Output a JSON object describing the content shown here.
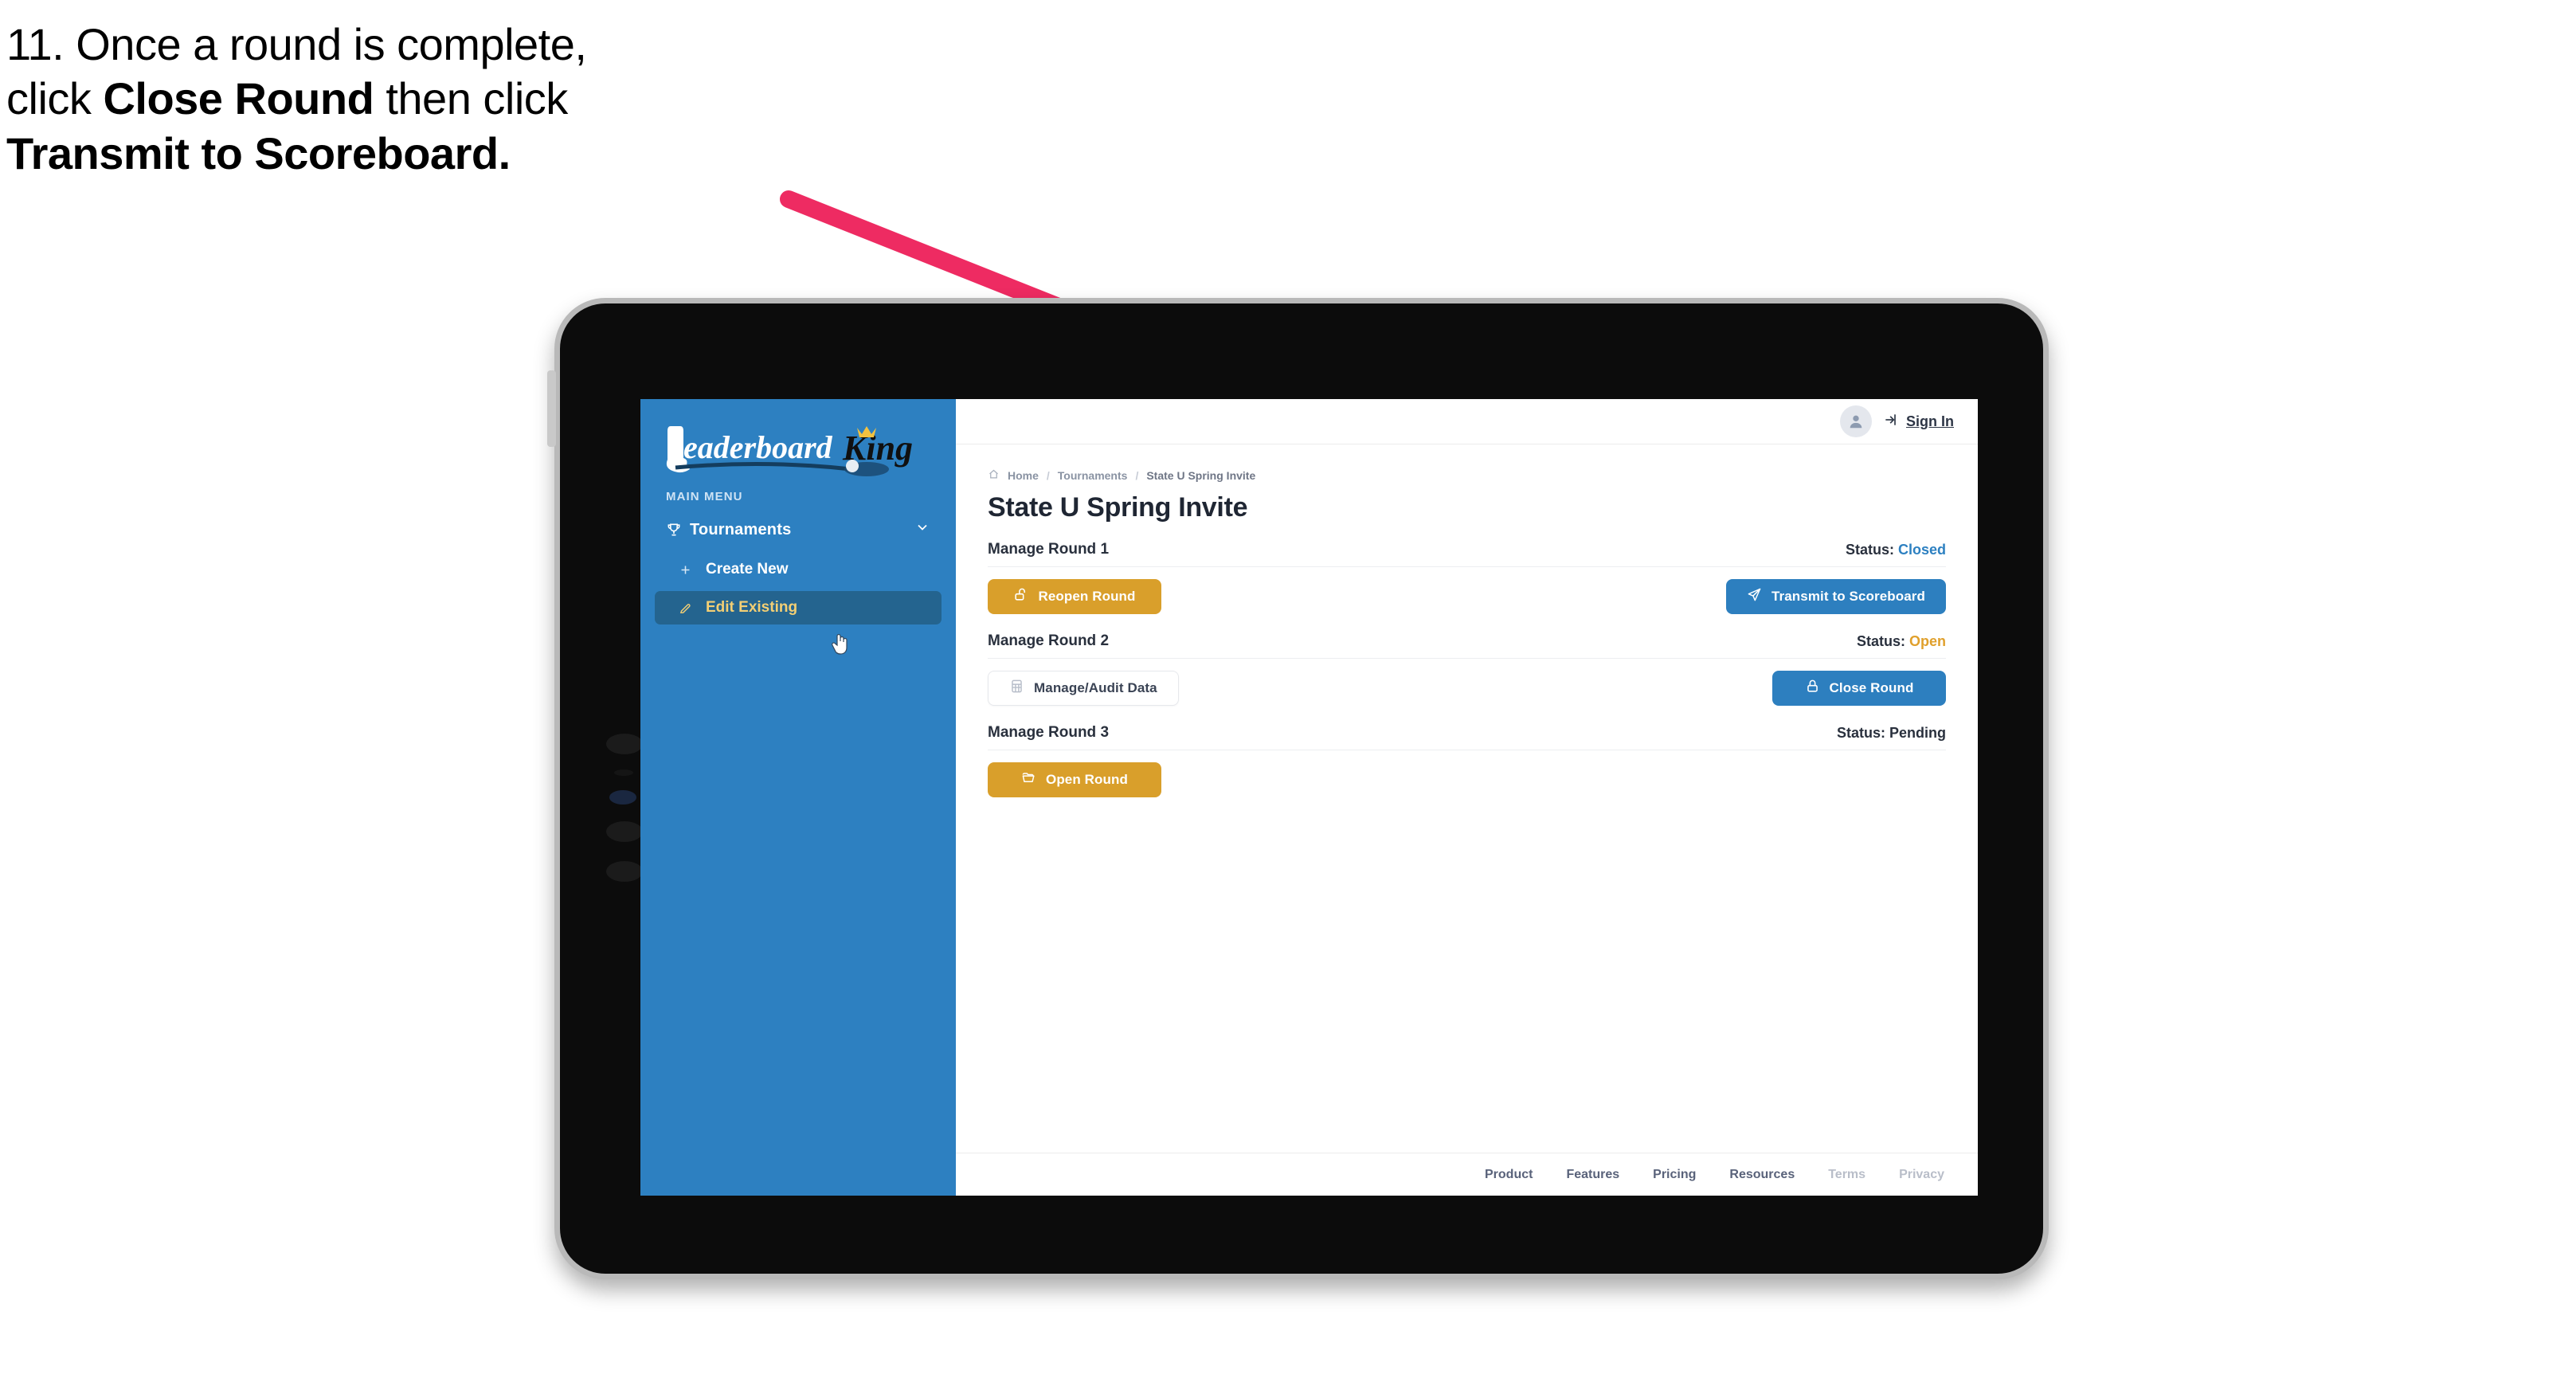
{
  "instruction": {
    "step_number": "11.",
    "line1_pre": "11. Once a round is complete,",
    "line2_pre": "click ",
    "line2_bold": "Close Round",
    "line2_post": " then click",
    "line3_bold": "Transmit to Scoreboard."
  },
  "colors": {
    "arrow": "#ee2b62",
    "sidebar_blue": "#2d80c1",
    "primary_blue": "#2d7fbf",
    "gold": "#d99f2b",
    "active_item_bg": "#24648f",
    "active_item_text": "#f3cf74",
    "status_open": "#e0a02c",
    "status_closed": "#2d80c1",
    "tablet_body": "#0c0c0c",
    "tablet_bezel": "#b9b9b9"
  },
  "sidebar": {
    "logo_text_primary": "Leaderboard",
    "logo_text_secondary": "King",
    "section_label": "MAIN MENU",
    "items": [
      {
        "label": "Tournaments",
        "icon": "trophy-icon",
        "expanded": true,
        "chevron": "chevron-down-icon"
      },
      {
        "label": "Create New",
        "icon": "plus-icon",
        "active": false
      },
      {
        "label": "Edit Existing",
        "icon": "edit-pencil-icon",
        "active": true
      }
    ]
  },
  "topbar": {
    "avatar_icon": "user-avatar-icon",
    "signin_label": "Sign In",
    "signin_icon": "login-arrow-icon"
  },
  "main": {
    "breadcrumb": {
      "home_icon": "home-icon",
      "items": [
        "Home",
        "Tournaments",
        "State U Spring Invite"
      ],
      "separator": "/"
    },
    "page_title": "State U Spring Invite",
    "rounds": [
      {
        "title": "Manage Round 1",
        "status_label": "Status:",
        "status_value": "Closed",
        "status_kind": "closed",
        "left_button": {
          "label": "Reopen Round",
          "icon": "unlock-icon",
          "style": "gold"
        },
        "right_button": {
          "label": "Transmit to Scoreboard",
          "icon": "paper-plane-icon",
          "style": "blue"
        }
      },
      {
        "title": "Manage Round 2",
        "status_label": "Status:",
        "status_value": "Open",
        "status_kind": "open",
        "left_button": {
          "label": "Manage/Audit Data",
          "icon": "table-grid-icon",
          "style": "ghost"
        },
        "right_button": {
          "label": "Close Round",
          "icon": "lock-icon",
          "style": "blue"
        }
      },
      {
        "title": "Manage Round 3",
        "status_label": "Status:",
        "status_value": "Pending",
        "status_kind": "pending",
        "left_button": {
          "label": "Open Round",
          "icon": "folder-open-icon",
          "style": "gold"
        },
        "right_button": null
      }
    ]
  },
  "footer": {
    "links": [
      {
        "label": "Product",
        "muted": false
      },
      {
        "label": "Features",
        "muted": false
      },
      {
        "label": "Pricing",
        "muted": false
      },
      {
        "label": "Resources",
        "muted": false
      },
      {
        "label": "Terms",
        "muted": true
      },
      {
        "label": "Privacy",
        "muted": true
      }
    ]
  }
}
